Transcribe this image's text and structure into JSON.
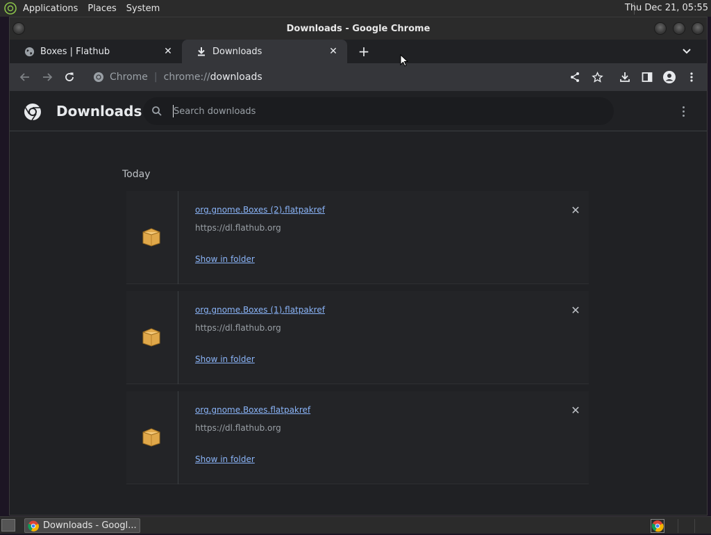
{
  "top_panel": {
    "menus": [
      "Applications",
      "Places",
      "System"
    ],
    "clock": "Thu Dec 21, 05:55"
  },
  "window": {
    "title": "Downloads - Google Chrome"
  },
  "tabs": [
    {
      "label": "Boxes | Flathub",
      "active": false
    },
    {
      "label": "Downloads",
      "active": true
    }
  ],
  "omnibox": {
    "site_chip": "Chrome",
    "url_scheme": "chrome://",
    "url_host": "downloads"
  },
  "downloads_page": {
    "title": "Downloads",
    "search_placeholder": "Search downloads",
    "section_label": "Today",
    "items": [
      {
        "filename": "org.gnome.Boxes (2).flatpakref",
        "source": "https://dl.flathub.org",
        "action": "Show in folder"
      },
      {
        "filename": "org.gnome.Boxes (1).flatpakref",
        "source": "https://dl.flathub.org",
        "action": "Show in folder"
      },
      {
        "filename": "org.gnome.Boxes.flatpakref",
        "source": "https://dl.flathub.org",
        "action": "Show in folder"
      }
    ]
  },
  "taskbar": {
    "task_label": "Downloads - Googl..."
  },
  "colors": {
    "link": "#8ab4f8",
    "page_bg": "#202124",
    "toolbar_bg": "#35363a",
    "panel_bg": "#2b2b2b"
  }
}
